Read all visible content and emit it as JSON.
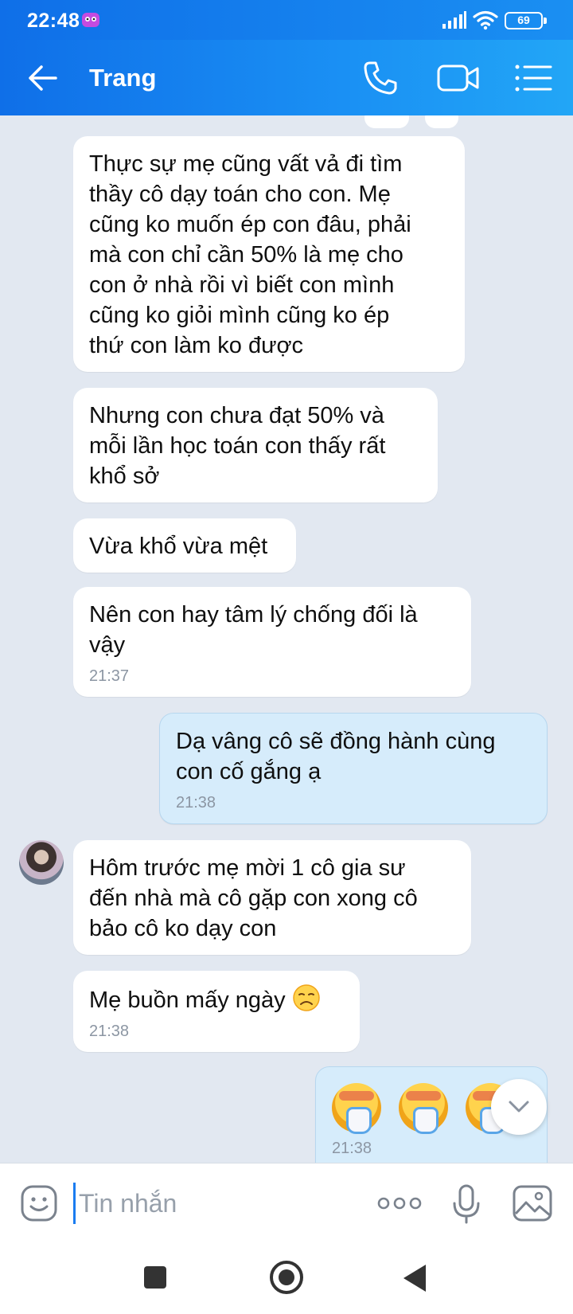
{
  "status_bar": {
    "time": "22:48",
    "battery": "69",
    "icons": [
      "app-notification-icon",
      "signal-icon",
      "wifi-icon",
      "battery-icon"
    ]
  },
  "header": {
    "title": "Trang",
    "icons": [
      "back-arrow-icon",
      "phone-icon",
      "video-call-icon",
      "menu-list-icon"
    ]
  },
  "messages": [
    {
      "direction": "in",
      "text": "Thực sự mẹ cũng vất vả đi tìm\nthầy cô dạy toán cho con. Mẹ\ncũng ko muốn ép con đâu, phải\nmà con chỉ cần 50% là mẹ cho\ncon ở nhà rồi vì biết con mình\ncũng ko giỏi mình cũng ko ép\nthứ con làm ko được"
    },
    {
      "direction": "in",
      "text": "Nhưng con chưa đạt 50% và\nmỗi lần học toán con thấy rất\nkhổ sở"
    },
    {
      "direction": "in",
      "text": "Vừa khổ vừa mệt"
    },
    {
      "direction": "in",
      "text": "Nên con hay tâm lý chống đối là\nvậy",
      "time": "21:37"
    },
    {
      "direction": "out",
      "text": "Dạ vâng cô sẽ đồng hành cùng\ncon cố gắng ạ",
      "time": "21:38"
    },
    {
      "direction": "in",
      "text": "Hôm trước mẹ mời 1 cô gia sư\nđến nhà mà cô gặp con xong cô\nbảo cô ko dạy con"
    },
    {
      "direction": "in",
      "text": "Mẹ buồn mấy ngày",
      "emoji": "sad-face-emoji",
      "time": "21:38"
    },
    {
      "direction": "out",
      "emojis": [
        "crying-face-emoji",
        "crying-face-emoji",
        "crying-face-emoji"
      ],
      "time": "21:38"
    }
  ],
  "input_bar": {
    "placeholder": "Tin nhắn",
    "icons": [
      "sticker-icon",
      "more-options-icon",
      "microphone-icon",
      "image-icon"
    ]
  },
  "colors": {
    "header_start": "#0f6fe8",
    "header_end": "#22a6f6",
    "chat_background": "#e2e8f1",
    "incoming_bubble": "#ffffff",
    "outgoing_bubble": "#d6ecfb",
    "timestamp": "#8c96a3"
  }
}
